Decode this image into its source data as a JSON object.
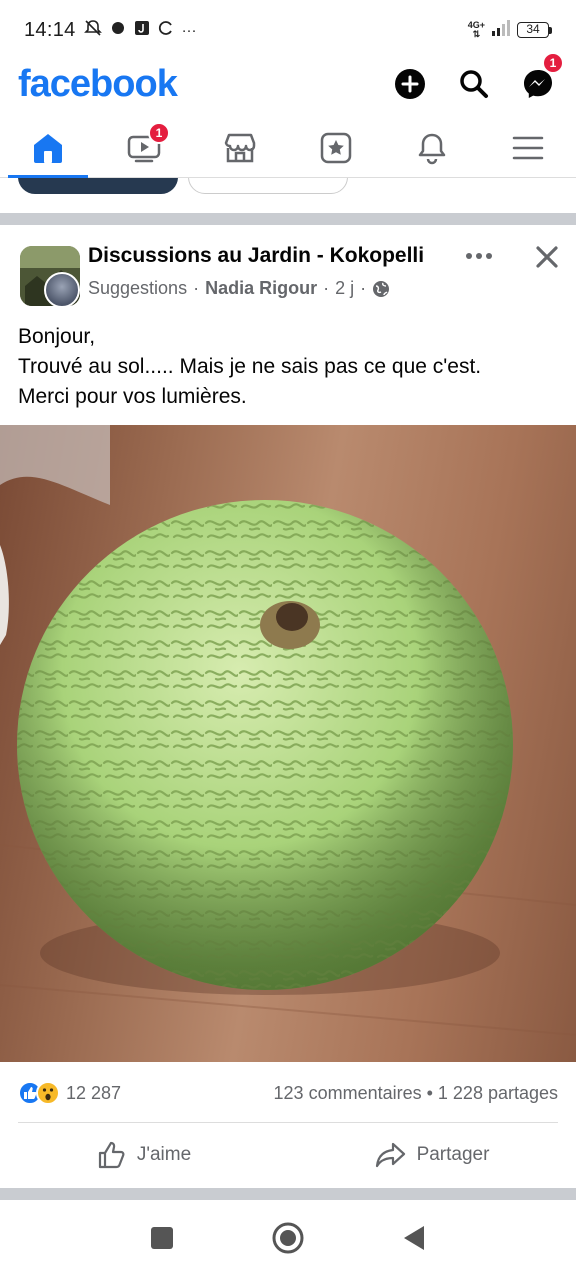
{
  "status_bar": {
    "time": "14:14",
    "more": "···",
    "network": "4G+",
    "battery": "34"
  },
  "header": {
    "logo": "facebook",
    "messenger_badge": "1",
    "accent_color": "#1877f2"
  },
  "tabs": [
    {
      "name": "home",
      "icon": "home-icon",
      "active": true
    },
    {
      "name": "watch",
      "icon": "video-icon",
      "badge": "1"
    },
    {
      "name": "marketplace",
      "icon": "marketplace-icon"
    },
    {
      "name": "feeds",
      "icon": "star-icon"
    },
    {
      "name": "notifications",
      "icon": "bell-icon"
    },
    {
      "name": "menu",
      "icon": "menu-icon"
    }
  ],
  "post": {
    "group": "Discussions au Jardin - Kokopelli",
    "source": "Suggestions",
    "sep1": "·",
    "author": "Nadia Rigour",
    "sep2": "·",
    "time": "2 j",
    "sep3": "·",
    "text_lines": [
      "Bonjour,",
      "Trouvé au sol..... Mais je ne sais pas ce que c'est.",
      "Merci pour vos lumières."
    ],
    "reaction_count": "12 287",
    "stats": "123 commentaires • 1 228 partages",
    "like_label": "J'aime",
    "share_label": "Partager"
  }
}
